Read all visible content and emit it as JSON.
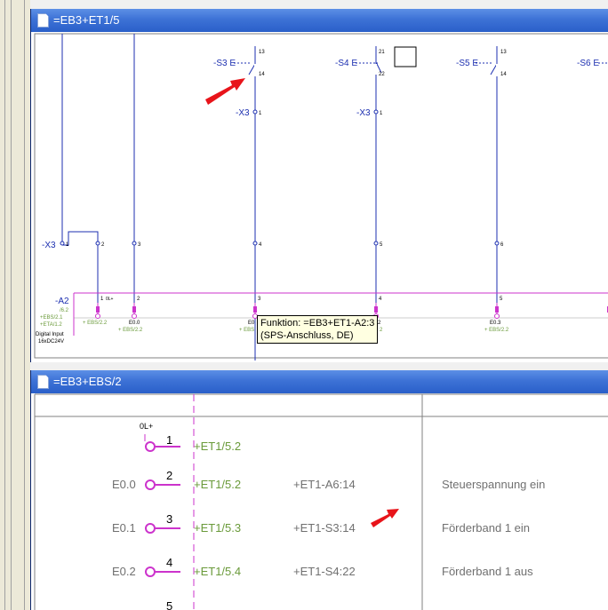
{
  "top_window": {
    "title": "=EB3+ET1/5",
    "labels": {
      "s3": "-S3 E",
      "s4": "-S4 E",
      "s5": "-S5 E",
      "s6": "-S6 E",
      "x3_a": "-X3",
      "x3_b": "-X3",
      "x3_left": "-X3",
      "t13a": "13",
      "t14a": "14",
      "t21": "21",
      "t22": "22",
      "t13b": "13",
      "t14b": "14",
      "x_1": "1",
      "x_2": "1",
      "x_l1": "1",
      "x_l2": "2",
      "x_l3": "3",
      "x_l4": "4",
      "x_l5": "5",
      "x_l6": "6",
      "a2": "-A2",
      "a2_sub1": "/6.2",
      "a2_sub2": "+EBS/2.1",
      "a2_sub3": "+ETA/1.2",
      "a2_d1": "Digital Input",
      "a2_d2": "16xDC24V",
      "p1": "1",
      "p1_sig": "0L+",
      "p2": "2",
      "p3": "3",
      "p4": "4",
      "p5": "5",
      "p1_ref": "+ EBS/2.2",
      "p2_name": "E0.0",
      "p2_ref": "+ EBS/2.2",
      "p3_name": "E0",
      "p3_ref": "+ EBS",
      "p4_name": "2",
      "p4_ref": "2",
      "p5_name": "E0.3",
      "p5_ref": "+ EBS/2.2"
    },
    "tooltip": {
      "line1": "Funktion: =EB3+ET1-A2:3",
      "line2": "(SPS-Anschluss, DE)"
    }
  },
  "bottom_window": {
    "title": "=EB3+EBS/2",
    "rows": [
      {
        "signal": "0L+",
        "num": "1",
        "addr": "",
        "ref": "+ET1/5.2",
        "device": "",
        "desc": ""
      },
      {
        "signal": "",
        "num": "2",
        "addr": "E0.0",
        "ref": "+ET1/5.2",
        "device": "+ET1-A6:14",
        "desc": "Steuerspannung ein"
      },
      {
        "signal": "",
        "num": "3",
        "addr": "E0.1",
        "ref": "+ET1/5.3",
        "device": "+ET1-S3:14",
        "desc": "Förderband 1 ein"
      },
      {
        "signal": "",
        "num": "4",
        "addr": "E0.2",
        "ref": "+ET1/5.4",
        "device": "+ET1-S4:22",
        "desc": "Förderband 1 aus"
      },
      {
        "signal": "",
        "num": "5",
        "addr": "",
        "ref": "",
        "device": "",
        "desc": ""
      }
    ]
  },
  "colors": {
    "wire": "#1c2fb0",
    "plc_box": "#cc33cc",
    "ref_green": "#6a9a3a",
    "arrow": "#e8141a",
    "titlebar": "#3d72d6"
  },
  "icons": [
    "doc-icon",
    "red-arrow-icon",
    "contact-symbol",
    "terminal-symbol",
    "plc-connection-symbol"
  ]
}
